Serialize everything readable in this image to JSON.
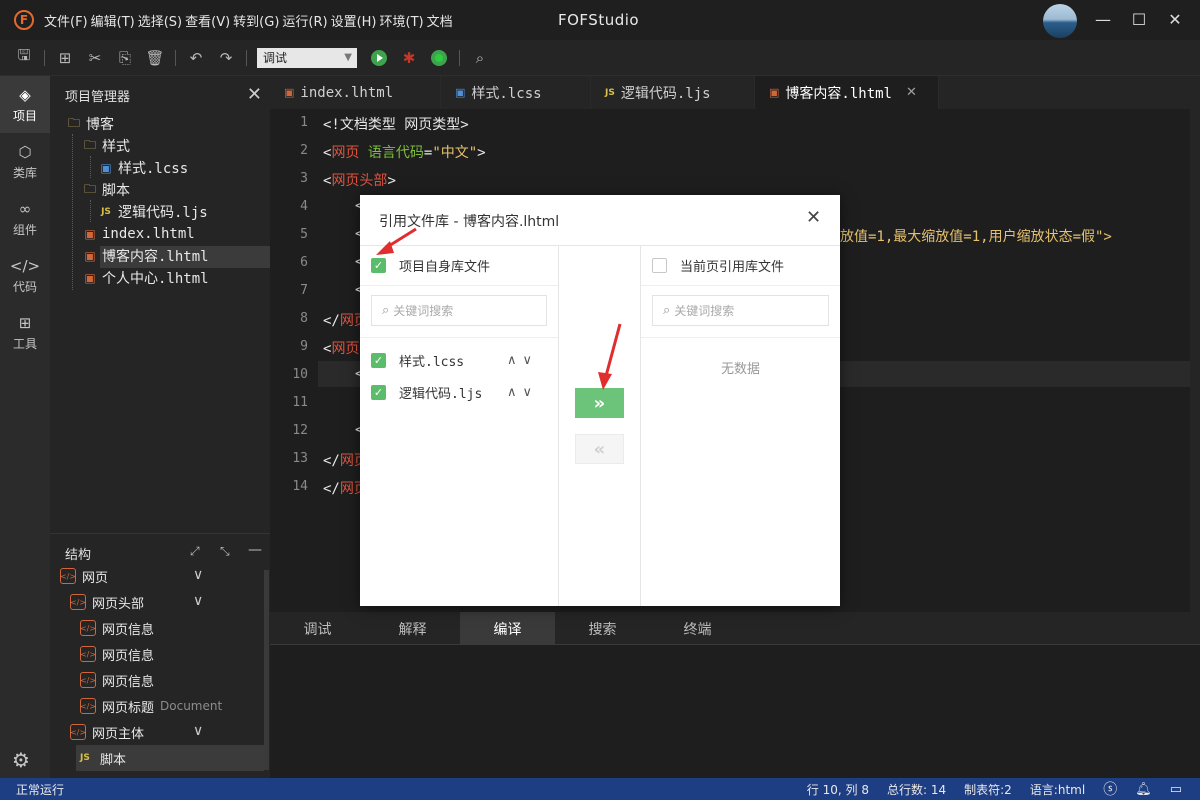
{
  "titlebar": {
    "menus": [
      "文件(F)",
      "编辑(T)",
      "选择(S)",
      "查看(V)",
      "转到(G)",
      "运行(R)",
      "设置(H)",
      "环境(T)",
      "文档"
    ],
    "app_title": "FOFStudio",
    "logo_letter": "F"
  },
  "toolbar": {
    "run_mode": "调试",
    "icons": [
      "save-icon",
      "save-all-icon",
      "cut-icon",
      "copy-icon",
      "delete-icon",
      "undo-icon",
      "redo-icon",
      "run-icon",
      "debug-icon",
      "stop-icon",
      "inspect-icon"
    ]
  },
  "activity": {
    "items": [
      {
        "label": "项目",
        "icon": "layers-icon"
      },
      {
        "label": "类库",
        "icon": "cube-icon"
      },
      {
        "label": "组件",
        "icon": "link-icon"
      },
      {
        "label": "代码",
        "icon": "code-icon"
      },
      {
        "label": "工具",
        "icon": "tools-icon"
      }
    ]
  },
  "explorer": {
    "title": "项目管理器",
    "tree": [
      {
        "label": "博客",
        "type": "folder"
      },
      {
        "label": "样式",
        "type": "folder"
      },
      {
        "label": "样式.lcss",
        "type": "lcss"
      },
      {
        "label": "脚本",
        "type": "folder"
      },
      {
        "label": "逻辑代码.ljs",
        "type": "ljs"
      },
      {
        "label": "index.lhtml",
        "type": "lhtml"
      },
      {
        "label": "博客内容.lhtml",
        "type": "lhtml"
      },
      {
        "label": "个人中心.lhtml",
        "type": "lhtml"
      }
    ]
  },
  "structure": {
    "title": "结构",
    "rows": [
      {
        "label": "网页",
        "extra": ""
      },
      {
        "label": "网页头部",
        "extra": ""
      },
      {
        "label": "网页信息",
        "extra": ""
      },
      {
        "label": "网页信息",
        "extra": ""
      },
      {
        "label": "网页信息",
        "extra": ""
      },
      {
        "label": "网页标题",
        "extra": "Document"
      },
      {
        "label": "网页主体",
        "extra": ""
      },
      {
        "label": "脚本",
        "extra": ""
      }
    ]
  },
  "tabs": [
    {
      "label": "index.lhtml",
      "icon": "lhtml"
    },
    {
      "label": "样式.lcss",
      "icon": "lcss"
    },
    {
      "label": "逻辑代码.ljs",
      "icon": "JS"
    },
    {
      "label": "博客内容.lhtml",
      "icon": "lhtml"
    }
  ],
  "editor": {
    "line_numbers": [
      "1",
      "2",
      "3",
      "4",
      "5",
      "6",
      "7",
      "8",
      "9",
      "10",
      "11",
      "12",
      "13",
      "14"
    ],
    "line1": "<!文档类型 网页类型>",
    "line2": {
      "lt": "<",
      "tag": "网页",
      "attr": " 语言代码",
      "eq": "=",
      "val": "\"中文\"",
      "gt": ">"
    },
    "line3": {
      "lt": "<",
      "tag": "网页头部",
      "gt": ">"
    },
    "line4": "<",
    "line5_lt": "<",
    "line5_tail": "放值=1,最大缩放值=1,用户缩放状态=假\">",
    "line6": "<",
    "line7": "<",
    "line8": {
      "lt": "</",
      "tag": "网页"
    },
    "line9": {
      "lt": "<",
      "tag": "网页"
    },
    "line10": "<",
    "line11": "",
    "line12": "<",
    "line13": {
      "lt": "</",
      "tag": "网页"
    },
    "line14": {
      "lt": "</",
      "tag": "网页"
    }
  },
  "bottom_tabs": [
    "调试",
    "解释",
    "编译",
    "搜索",
    "终端"
  ],
  "statusbar": {
    "left": "正常运行",
    "position": "行 10, 列 8",
    "total_lines": "总行数: 14",
    "tab_size": "制表符:2",
    "language": "语言:html"
  },
  "dialog": {
    "title": "引用文件库 - 博客内容.lhtml",
    "left_header": "项目自身库文件",
    "right_header": "当前页引用库文件",
    "left_search_placeholder": "关键词搜索",
    "right_search_placeholder": "关键词搜索",
    "left_items": [
      "样式.lcss",
      "逻辑代码.ljs"
    ],
    "right_empty": "无数据",
    "move_right": "»",
    "move_left": "«",
    "accent": "#5bbd6c"
  }
}
